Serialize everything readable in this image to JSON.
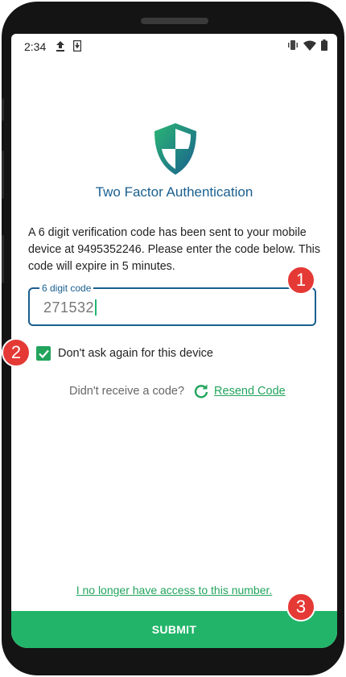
{
  "status_bar": {
    "time": "2:34",
    "left_icons": [
      "upload-icon",
      "sim-download-icon"
    ],
    "right_icons": [
      "vibrate-icon",
      "wifi-icon",
      "battery-icon"
    ]
  },
  "header": {
    "icon": "shield-icon",
    "title": "Two Factor Authentication"
  },
  "message": "A 6 digit verification code has been sent to your mobile device at 9495352246. Please enter the code below. This code will expire in 5 minutes.",
  "code_field": {
    "label": "6 digit code",
    "value": "271532"
  },
  "remember_device": {
    "label": "Don't ask again for this device",
    "checked": true
  },
  "resend": {
    "prompt": "Didn't receive a code?",
    "icon": "refresh-icon",
    "link": "Resend Code"
  },
  "no_access_link": "I no longer have access to this number.",
  "submit_label": "SUBMIT",
  "callouts": [
    "1",
    "2",
    "3"
  ],
  "colors": {
    "primary_blue": "#1a5f8f",
    "accent_green": "#22b56a",
    "callout_red": "#e53935"
  }
}
